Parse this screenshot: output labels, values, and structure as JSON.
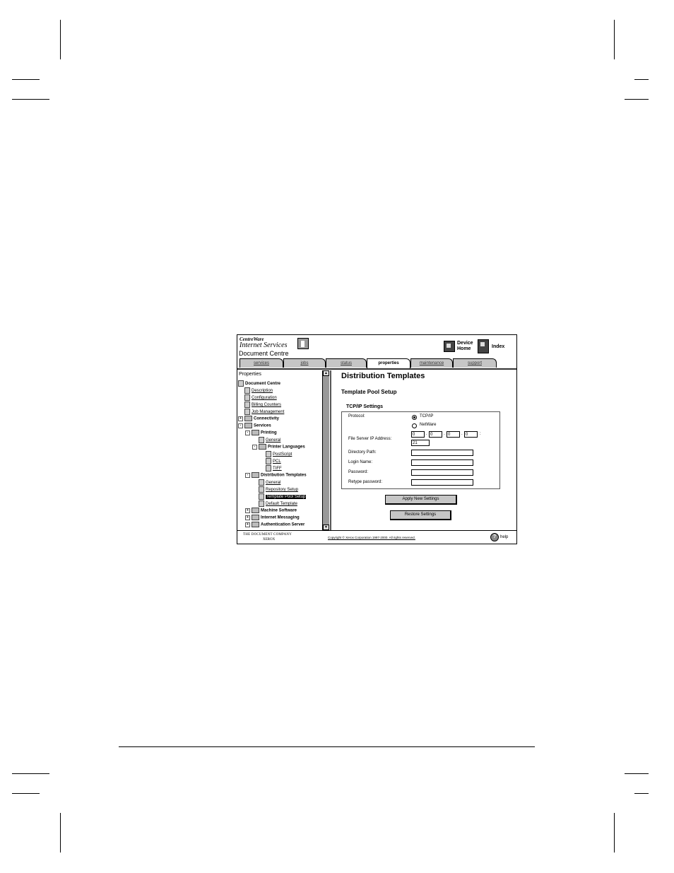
{
  "header": {
    "brand_line1": "CentreWare",
    "brand_line2": "Internet Services",
    "device_name": "Document Centre",
    "device_home_line1": "Device",
    "device_home_line2": "Home",
    "index_label": "Index"
  },
  "tabs": [
    {
      "label": "services",
      "active": false
    },
    {
      "label": "jobs",
      "active": false
    },
    {
      "label": "status",
      "active": false
    },
    {
      "label": "properties",
      "active": true
    },
    {
      "label": "maintenance",
      "active": false
    },
    {
      "label": "support",
      "active": false
    }
  ],
  "tree": {
    "title": "Properties",
    "nodes": {
      "root": "Document Centre",
      "description": "Description",
      "configuration": "Configuration",
      "billing": "Billing Counters",
      "job_mgmt": "Job Management",
      "connectivity": "Connectivity",
      "services": "Services",
      "printing": "Printing",
      "general": "General",
      "printer_languages": "Printer Languages",
      "postscript": "PostScript",
      "pcl": "PCL",
      "tiff": "TIFF",
      "dist_templates": "Distribution Templates",
      "dt_general": "General",
      "repository": "Repository Setup",
      "template_pool": "Template Pool Setup",
      "default_template": "Default Template",
      "machine_software": "Machine Software",
      "internet_messaging": "Internet Messaging",
      "auth_server": "Authentication Server"
    }
  },
  "main": {
    "title": "Distribution Templates",
    "subtitle": "Template Pool Setup",
    "section": "TCP/IP Settings",
    "protocol_label": "Protocol:",
    "protocol_options": [
      "TCP/IP",
      "NetWare"
    ],
    "protocol_selected": "TCP/IP",
    "ip_label": "File Server IP Address:",
    "ip_octets": [
      "0",
      "0",
      "0",
      "0"
    ],
    "port": "21",
    "directory_label": "Directory Path:",
    "login_label": "Login Name:",
    "password_label": "Password:",
    "retype_label": "Retype password:",
    "apply_button": "Apply New Settings",
    "restore_button": "Restore Settings"
  },
  "footer": {
    "company_line1": "THE DOCUMENT COMPANY",
    "company_line2": "XEROX",
    "copyright": "Copyright © Xerox Corporation 1997-2000. All rights reserved.",
    "help_label": "help"
  }
}
